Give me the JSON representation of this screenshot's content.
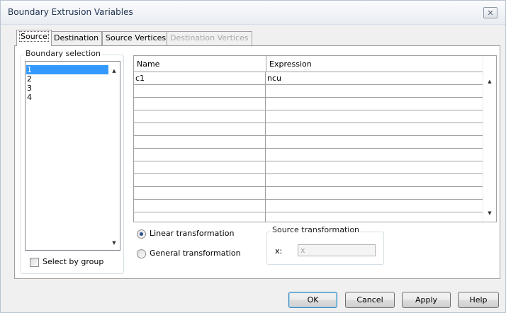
{
  "window": {
    "title": "Boundary Extrusion Variables",
    "close_glyph": "✕"
  },
  "tabs": [
    {
      "label": "Source",
      "state": "active"
    },
    {
      "label": "Destination",
      "state": "normal"
    },
    {
      "label": "Source Vertices",
      "state": "normal"
    },
    {
      "label": "Destination Vertices",
      "state": "disabled"
    }
  ],
  "boundary_selection": {
    "group_label": "Boundary selection",
    "items": [
      "1",
      "2",
      "3",
      "4"
    ],
    "selected": "1",
    "select_by_group_label": "Select by group",
    "select_by_group_checked": false
  },
  "variables_table": {
    "headers": {
      "name": "Name",
      "expression": "Expression"
    },
    "rows": [
      {
        "name": "c1",
        "expression": "ncu"
      }
    ],
    "empty_row_count": 11
  },
  "transformation": {
    "linear_label": "Linear transformation",
    "general_label": "General transformation",
    "selected": "linear"
  },
  "source_transformation": {
    "group_label": "Source transformation",
    "x_label": "x:",
    "x_value": "x"
  },
  "buttons": {
    "ok": "OK",
    "cancel": "Cancel",
    "apply": "Apply",
    "help": "Help"
  },
  "icons": {
    "scroll_up": "▲",
    "scroll_down": "▼"
  },
  "colors": {
    "selection": "#3399ff",
    "titlebar_text": "#1e3150"
  }
}
